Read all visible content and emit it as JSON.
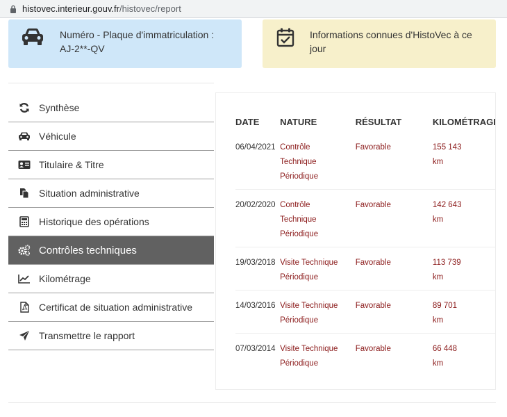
{
  "browser": {
    "url_host": "histovec.interieur.gouv.fr",
    "url_path": "/histovec/report"
  },
  "cards": {
    "plate": {
      "label": "Numéro - Plaque d'immatriculation : AJ-2**-QV",
      "icon": "car-icon"
    },
    "info": {
      "label": "Informations connues d'HistoVec à ce jour",
      "icon": "calendar-check-icon"
    }
  },
  "sidebar": {
    "items": [
      {
        "label": "Synthèse",
        "icon": "sync-icon",
        "active": false
      },
      {
        "label": "Véhicule",
        "icon": "car-icon",
        "active": false
      },
      {
        "label": "Titulaire & Titre",
        "icon": "id-card-icon",
        "active": false
      },
      {
        "label": "Situation administrative",
        "icon": "copy-icon",
        "active": false
      },
      {
        "label": "Historique des opérations",
        "icon": "calculator-icon",
        "active": false
      },
      {
        "label": "Contrôles techniques",
        "icon": "cogs-icon",
        "active": true
      },
      {
        "label": "Kilométrage",
        "icon": "line-chart-icon",
        "active": false
      },
      {
        "label": "Certificat de situation administrative",
        "icon": "pdf-file-icon",
        "active": false
      },
      {
        "label": "Transmettre le rapport",
        "icon": "send-icon",
        "active": false
      }
    ],
    "active_color": "#616161"
  },
  "table": {
    "headers": {
      "date": "DATE",
      "nature": "NATURE",
      "result": "RÉSULTAT",
      "km": "KILOMÉTRAGE"
    },
    "rows": [
      {
        "date": "06/04/2021",
        "nature": [
          "Contrôle",
          "Technique",
          "Périodique"
        ],
        "result": "Favorable",
        "km": [
          "155 143",
          "km"
        ]
      },
      {
        "date": "20/02/2020",
        "nature": [
          "Contrôle",
          "Technique",
          "Périodique"
        ],
        "result": "Favorable",
        "km": [
          "142 643",
          "km"
        ]
      },
      {
        "date": "19/03/2018",
        "nature": [
          "Visite Technique",
          "Périodique"
        ],
        "result": "Favorable",
        "km": [
          "113 739",
          "km"
        ]
      },
      {
        "date": "14/03/2016",
        "nature": [
          "Visite Technique",
          "Périodique"
        ],
        "result": "Favorable",
        "km": [
          "89 701",
          "km"
        ]
      },
      {
        "date": "07/03/2014",
        "nature": [
          "Visite Technique",
          "Périodique"
        ],
        "result": "Favorable",
        "km": [
          "66 448",
          "km"
        ]
      }
    ],
    "value_color": "#8b1a1a"
  }
}
